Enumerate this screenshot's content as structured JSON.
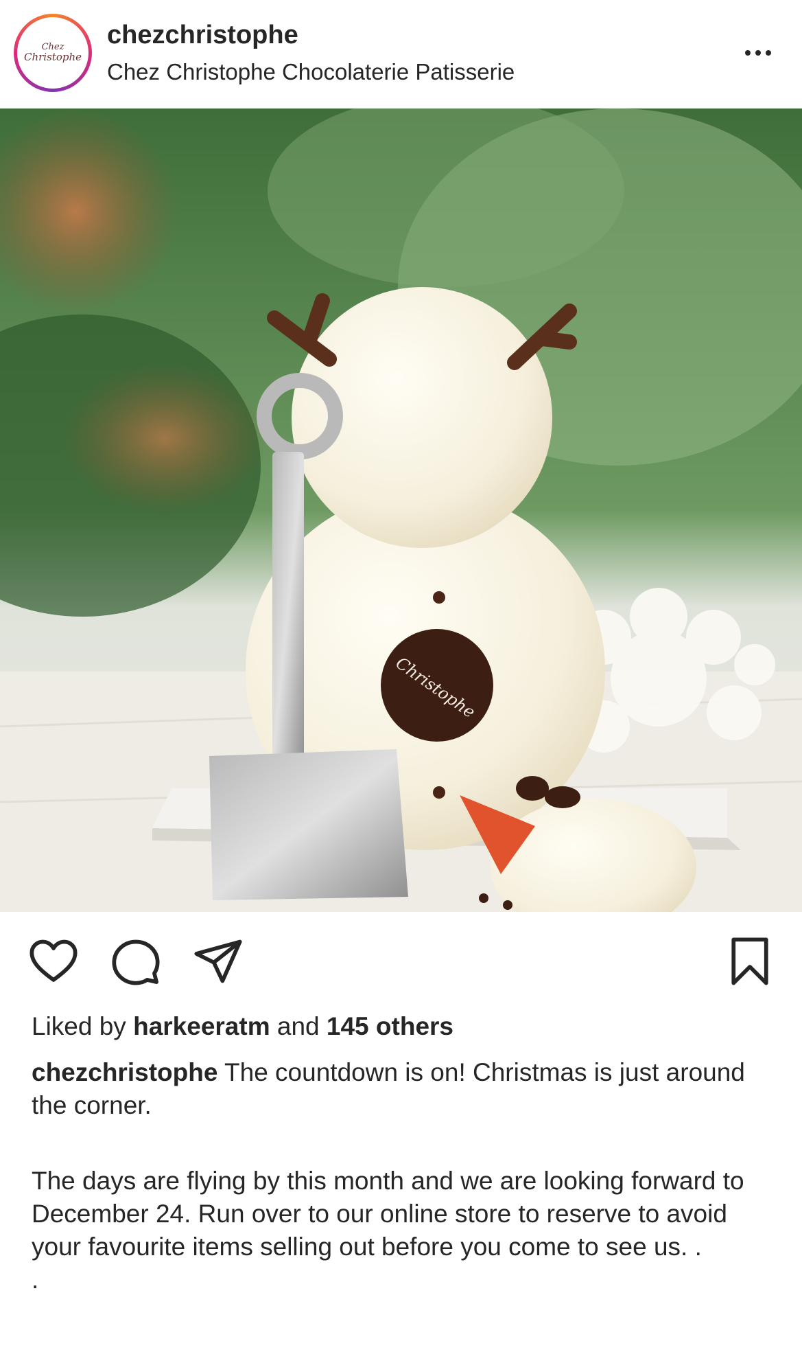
{
  "header": {
    "avatar_text_line1": "Chez",
    "avatar_text_line2": "Christophe",
    "username": "chezchristophe",
    "subtitle": "Chez Christophe Chocolaterie Patisserie",
    "more_icon": "more-horizontal-icon"
  },
  "photo": {
    "medallion_text": "Christophe",
    "description_icon": "post-image"
  },
  "actions": {
    "like_icon": "heart-icon",
    "comment_icon": "comment-icon",
    "share_icon": "send-icon",
    "save_icon": "bookmark-icon"
  },
  "likes": {
    "prefix": "Liked by ",
    "user": "harkeeratm",
    "middle": " and ",
    "count_text": "145 others"
  },
  "caption": {
    "user": "chezchristophe",
    "line1": " The countdown is on! Christmas is just around the corner.",
    "paragraph2": "The days are flying by this month and we are looking forward to December 24. Run over to our online store to reserve to avoid your favourite items selling out before you come to see us. .",
    "trailing": "."
  },
  "colors": {
    "text": "#262626",
    "story_ring_start": "#f58529",
    "story_ring_mid": "#dd2a7b",
    "story_ring_end": "#8134af"
  }
}
